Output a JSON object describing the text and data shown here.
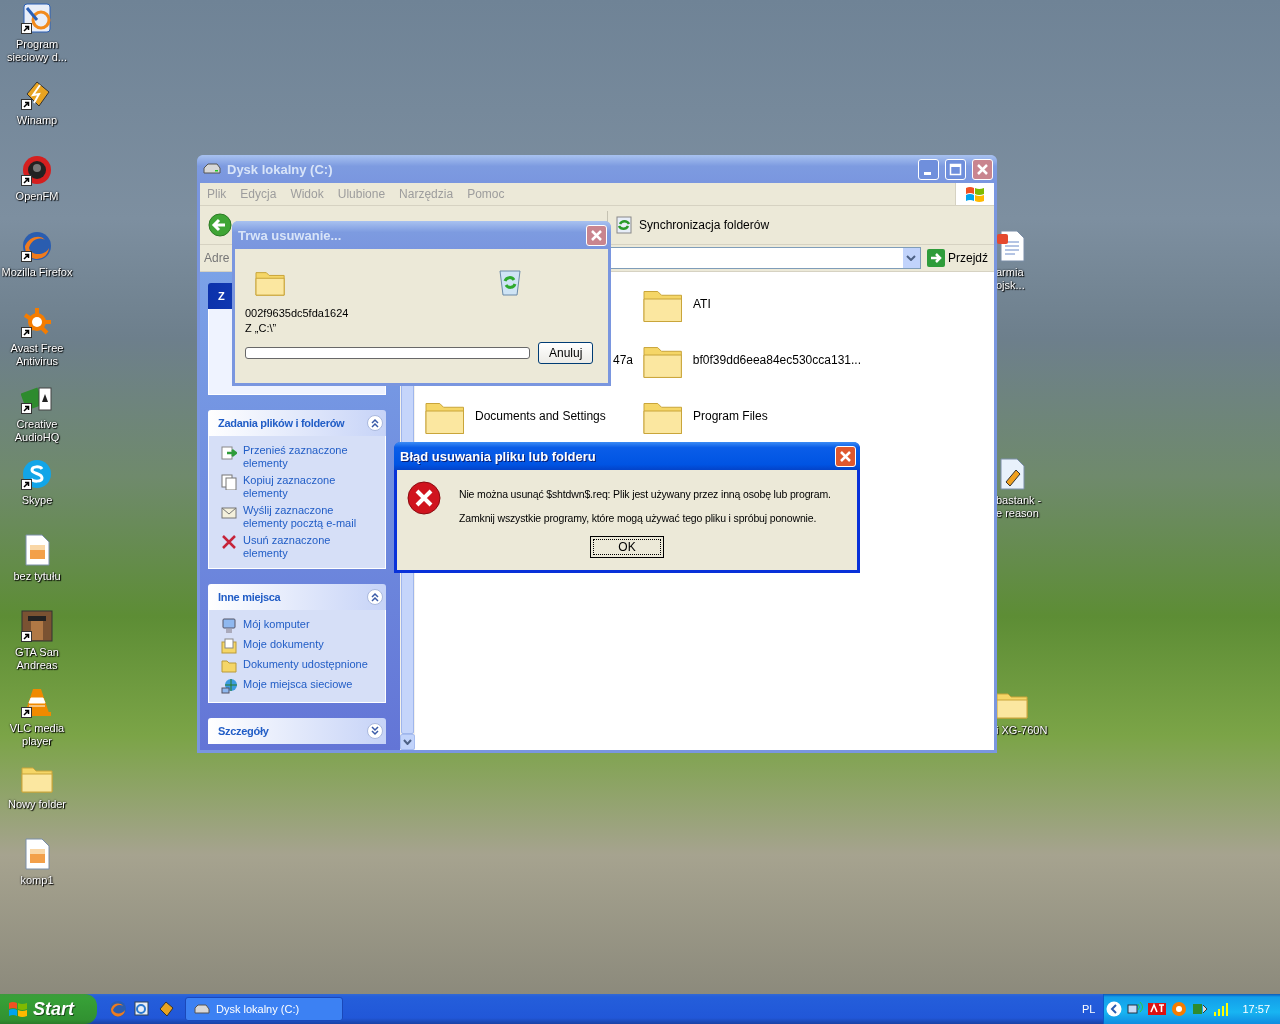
{
  "desktop_icons": [
    {
      "label": "Program sieciowy d...",
      "kind": "network",
      "shortcut": true
    },
    {
      "label": "Winamp",
      "kind": "winamp",
      "shortcut": true
    },
    {
      "label": "OpenFM",
      "kind": "radio",
      "shortcut": true
    },
    {
      "label": "Mozilla Firefox",
      "kind": "firefox",
      "shortcut": true
    },
    {
      "label": "Avast Free Antivirus",
      "kind": "antivirus",
      "shortcut": true
    },
    {
      "label": "Creative AudioHQ",
      "kind": "audio",
      "shortcut": true
    },
    {
      "label": "Skype",
      "kind": "skype",
      "shortcut": true
    },
    {
      "label": "bez tytułu",
      "kind": "image",
      "shortcut": false
    },
    {
      "label": "GTA San Andreas",
      "kind": "game",
      "shortcut": true
    },
    {
      "label": "VLC media player",
      "kind": "vlc",
      "shortcut": true
    },
    {
      "label": "Nowy folder",
      "kind": "folder",
      "shortcut": false
    },
    {
      "label": "komp1",
      "kind": "image",
      "shortcut": false
    }
  ],
  "desktop_icons_right": [
    {
      "label": "armia\nojsk...",
      "kind": "document"
    },
    {
      "label": "bastank -\ne reason",
      "kind": "media"
    },
    {
      "label": "i XG-760N",
      "kind": "folder"
    }
  ],
  "explorer": {
    "title": "Dysk lokalny (C:)",
    "active": false,
    "menu": [
      "Plik",
      "Edycja",
      "Widok",
      "Ulubione",
      "Narzędzia",
      "Pomoc"
    ],
    "toolbar": {
      "sync_button": "Synchronizacja folderów"
    },
    "address": {
      "label": "Adre",
      "go_button": "Przejdź"
    },
    "task_sections": [
      {
        "title": "Z",
        "kind": "special",
        "expanded": true
      },
      {
        "title": "Zadania plików i folderów",
        "kind": "normal",
        "expanded": true,
        "items": [
          {
            "label": "Przenieś zaznaczone elementy",
            "kind": "move"
          },
          {
            "label": "Kopiuj zaznaczone elementy",
            "kind": "copy"
          },
          {
            "label": "Wyślij zaznaczone elementy pocztą e-mail",
            "kind": "mail"
          },
          {
            "label": "Usuń zaznaczone elementy",
            "kind": "delete"
          }
        ]
      },
      {
        "title": "Inne miejsca",
        "kind": "normal",
        "expanded": true,
        "items": [
          {
            "label": "Mój komputer",
            "kind": "computer"
          },
          {
            "label": "Moje dokumenty",
            "kind": "documents"
          },
          {
            "label": "Dokumenty udostępnione",
            "kind": "folder"
          },
          {
            "label": "Moje miejsca sieciowe",
            "kind": "network"
          }
        ]
      },
      {
        "title": "Szczegóły",
        "kind": "normal",
        "expanded": false
      }
    ],
    "folders": [
      {
        "kind": "covered"
      },
      {
        "label": "ATI",
        "kind": "folder"
      },
      {
        "label": "47a",
        "kind": "partial"
      },
      {
        "label": "bf0f39dd6eea84ec530cca131...",
        "kind": "folder"
      },
      {
        "label": "Documents and Settings",
        "kind": "folder"
      },
      {
        "label": "Program Files",
        "kind": "folder"
      }
    ]
  },
  "progress_dialog": {
    "title": "Trwa usuwanie...",
    "active": false,
    "file": "002f9635dc5fda1624",
    "source": "Z „C:\\”",
    "level": 0,
    "cancel_button": "Anuluj"
  },
  "error_dialog": {
    "title": "Błąd usuwania pliku lub folderu",
    "active": true,
    "message": "Nie można usunąć $shtdwn$.req: Plik jest używany przez inną osobę lub program.",
    "hint": "Zamknij wszystkie programy, które mogą używać tego pliku i spróbuj ponownie.",
    "ok_button": "OK"
  },
  "taskbar": {
    "start": "Start",
    "tasks": [
      {
        "label": "Dysk lokalny (C:)",
        "selected": false
      }
    ],
    "language": "PL",
    "clock": "17:57"
  }
}
